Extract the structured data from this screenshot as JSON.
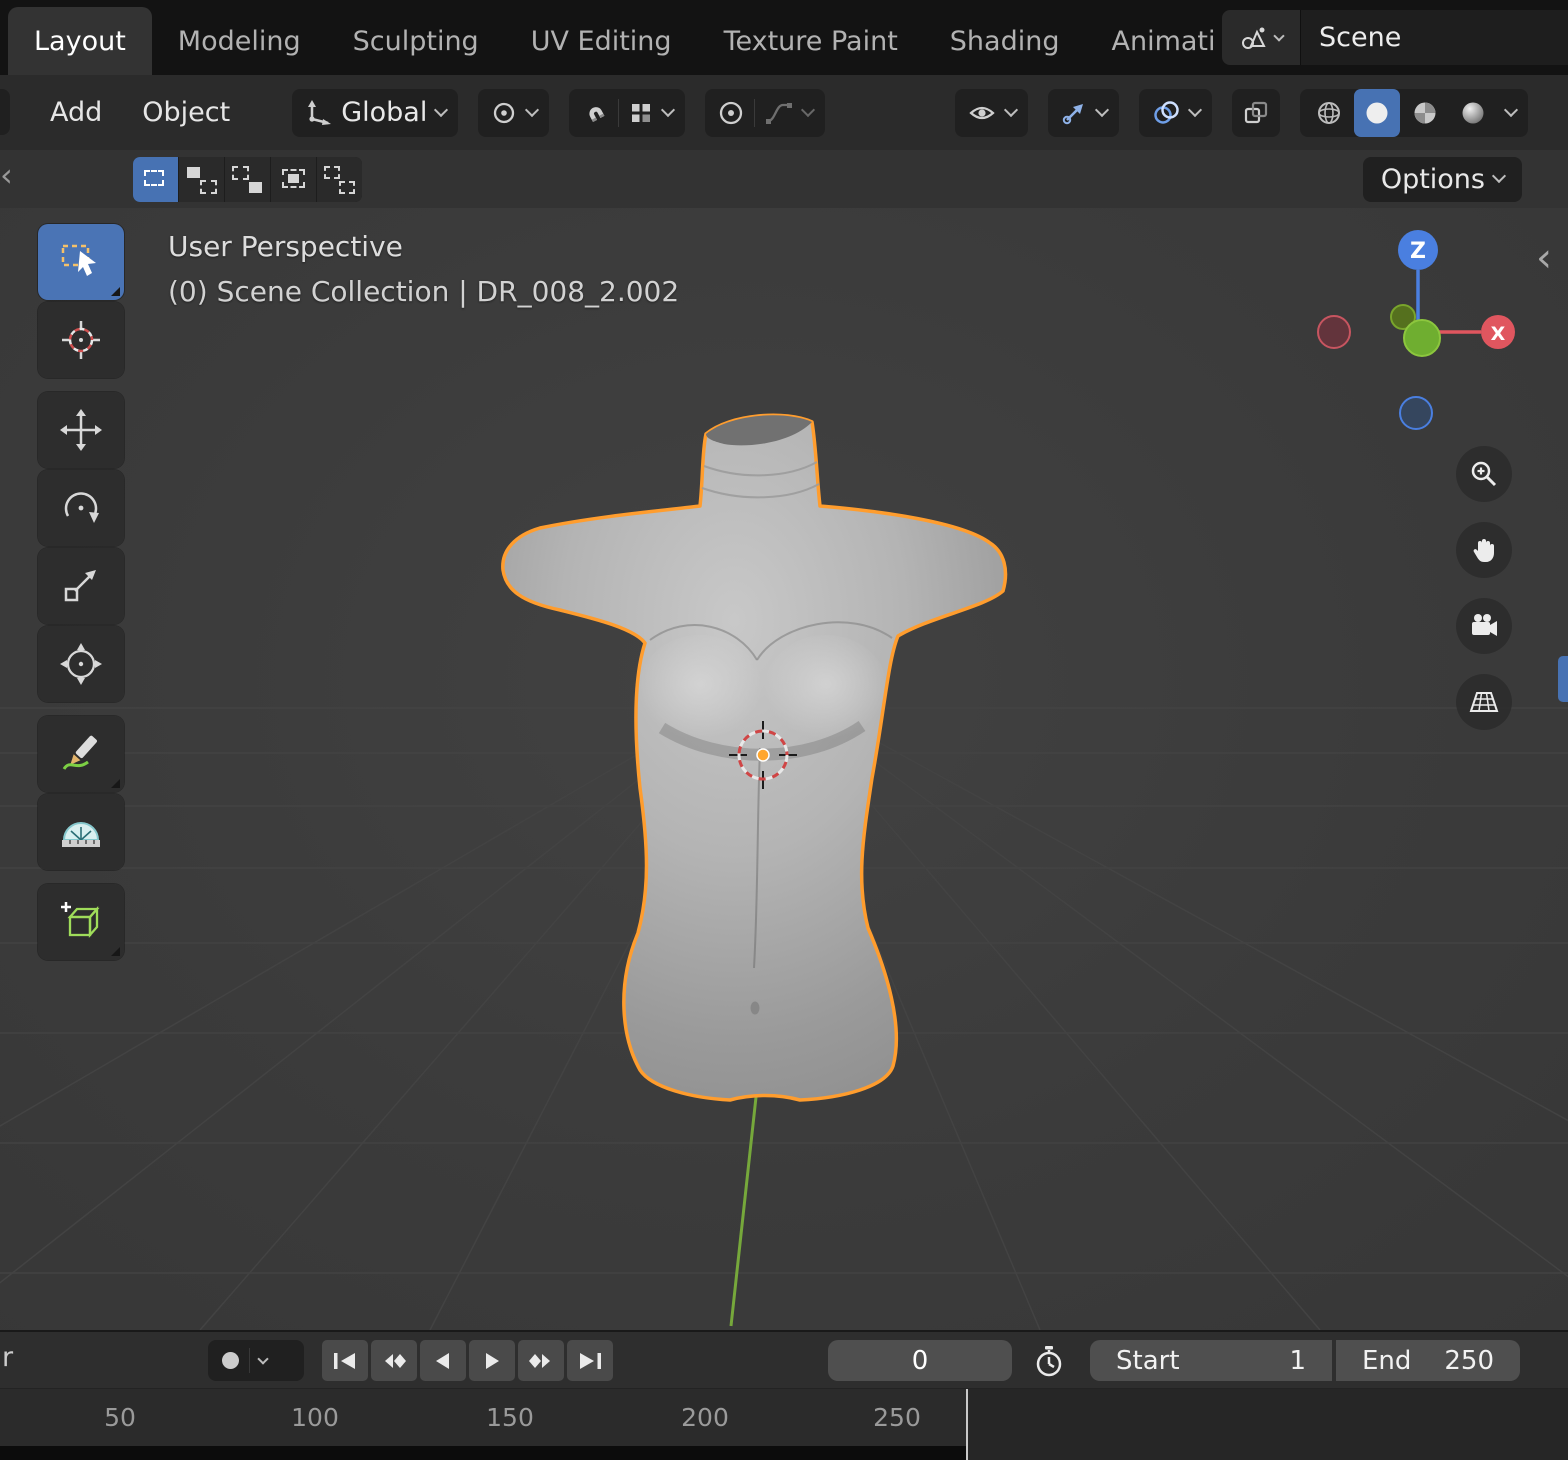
{
  "topbar": {
    "tabs": [
      {
        "label": "Layout",
        "active": true
      },
      {
        "label": "Modeling"
      },
      {
        "label": "Sculpting"
      },
      {
        "label": "UV Editing"
      },
      {
        "label": "Texture Paint"
      },
      {
        "label": "Shading"
      },
      {
        "label": "Animati"
      }
    ],
    "scene_selector": {
      "value": "Scene"
    }
  },
  "header": {
    "menus": [
      {
        "label": "Add"
      },
      {
        "label": "Object"
      }
    ],
    "orientation": {
      "value": "Global"
    }
  },
  "tool_settings": {
    "options_label": "Options"
  },
  "viewport": {
    "info_line1": "User Perspective",
    "info_line2": "(0) Scene Collection | DR_008_2.002",
    "gizmo": {
      "z_label": "Z",
      "x_label": "X"
    }
  },
  "timeline": {
    "partial_label": "r",
    "frame_value": "0",
    "start_label": "Start",
    "start_value": "1",
    "end_label": "End",
    "end_value": "250"
  },
  "ruler": {
    "ticks": [
      "50",
      "100",
      "150",
      "200",
      "250"
    ]
  },
  "colors": {
    "accent_blue": "#4772b3",
    "selection_outline": "#ff9d2e",
    "axis_x": "#e0565f",
    "axis_y": "#6fae30",
    "axis_z": "#4a7fe0"
  }
}
